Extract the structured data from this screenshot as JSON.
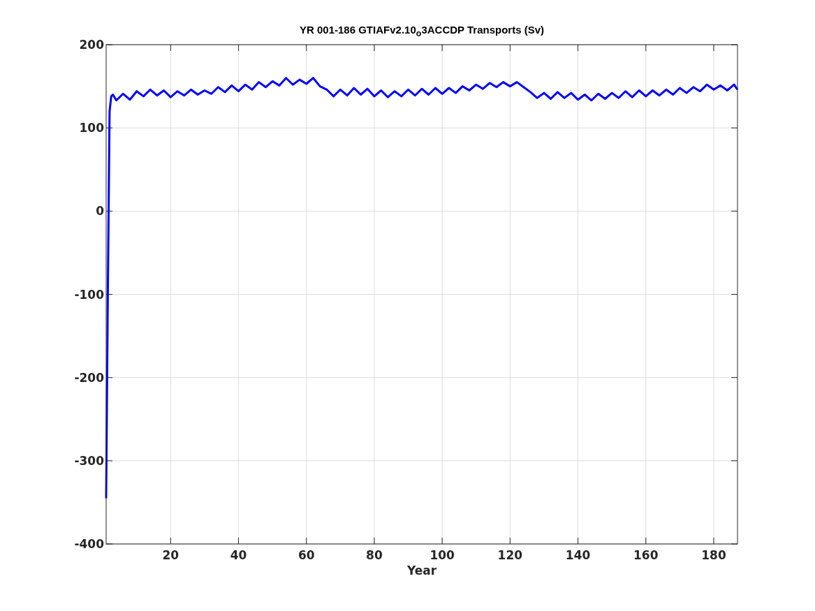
{
  "figure": {
    "chart_data": {
      "type": "line",
      "grid": true,
      "title": "YR 001-186 GTIAFv2.10$_{o}$3ACCDP Transports (Sv)",
      "xlabel": "Year",
      "xlim": [
        1,
        187
      ],
      "ylim": [
        -400,
        200
      ],
      "xticks": [
        20,
        40,
        60,
        80,
        100,
        120,
        140,
        160,
        180
      ],
      "yticks": [
        -400,
        -300,
        -200,
        -100,
        0,
        100,
        200
      ],
      "x": [
        1,
        1.5,
        2,
        2.5,
        3,
        4,
        6,
        8,
        10,
        12,
        14,
        16,
        18,
        20,
        22,
        24,
        26,
        28,
        30,
        32,
        34,
        36,
        38,
        40,
        42,
        44,
        46,
        48,
        50,
        52,
        54,
        56,
        58,
        60,
        62,
        64,
        66,
        68,
        70,
        72,
        74,
        76,
        78,
        80,
        82,
        84,
        86,
        88,
        90,
        92,
        94,
        96,
        98,
        100,
        102,
        104,
        106,
        108,
        110,
        112,
        114,
        116,
        118,
        120,
        122,
        124,
        126,
        128,
        130,
        132,
        134,
        136,
        138,
        140,
        142,
        144,
        146,
        148,
        150,
        152,
        154,
        156,
        158,
        160,
        162,
        164,
        166,
        168,
        170,
        172,
        174,
        176,
        178,
        180,
        182,
        184,
        186,
        187
      ],
      "series": [
        {
          "color": "#0000ff",
          "values": [
            -345,
            -100,
            120,
            138,
            140,
            133,
            141,
            134,
            144,
            138,
            146,
            139,
            145,
            137,
            144,
            139,
            146,
            140,
            145,
            141,
            149,
            143,
            151,
            144,
            152,
            146,
            155,
            149,
            156,
            151,
            160,
            152,
            158,
            153,
            160,
            150,
            146,
            138,
            146,
            139,
            148,
            140,
            147,
            138,
            145,
            137,
            144,
            138,
            146,
            139,
            147,
            140,
            148,
            141,
            148,
            142,
            150,
            145,
            152,
            147,
            154,
            149,
            155,
            150,
            155,
            149,
            143,
            136,
            142,
            135,
            143,
            136,
            142,
            134,
            140,
            133,
            141,
            135,
            142,
            136,
            144,
            137,
            145,
            138,
            145,
            139,
            146,
            140,
            148,
            142,
            149,
            144,
            152,
            146,
            151,
            145,
            152,
            146
          ]
        }
      ]
    }
  }
}
